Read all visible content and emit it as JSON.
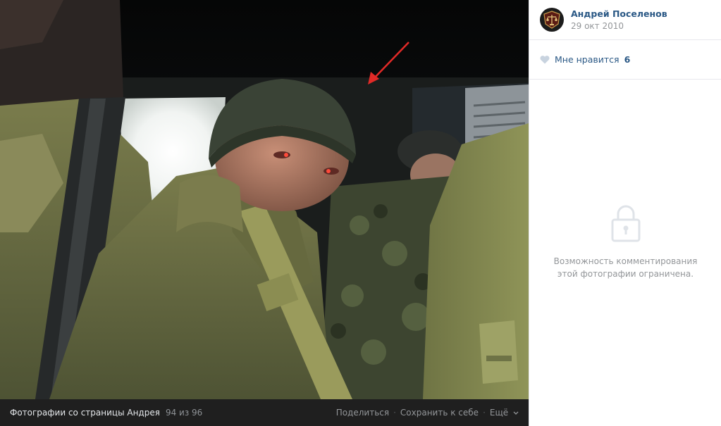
{
  "viewer": {
    "album_title": "Фотографии со страницы Андрея",
    "counter": "94 из 96",
    "actions": {
      "share": "Поделиться",
      "save": "Сохранить к себе",
      "more": "Ещё"
    }
  },
  "panel": {
    "author_name": "Андрей Поселенов",
    "post_date": "29 окт 2010",
    "likes": {
      "label": "Мне нравится",
      "count": "6"
    },
    "comments_closed": "Возможность комментирования этой фотографии ограничена."
  },
  "icons": {
    "heart": "heart-icon",
    "lock": "lock-icon",
    "more_chevron": "chevron-down-icon"
  },
  "colors": {
    "link": "#2a5885",
    "muted": "#939699",
    "bar_bg": "#1f1f1f",
    "panel_border": "#e7e8ec"
  }
}
